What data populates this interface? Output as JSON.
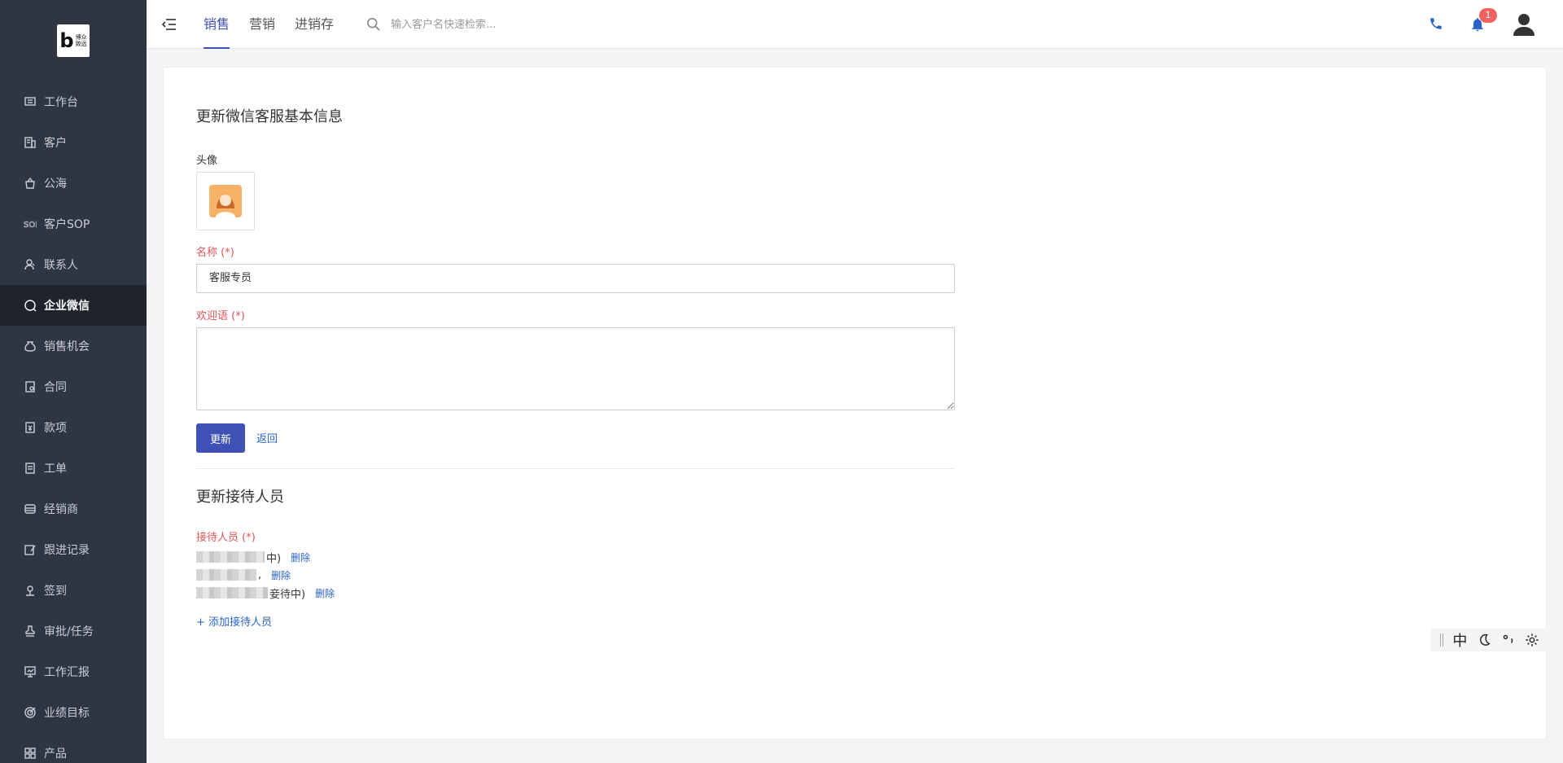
{
  "sidebar": {
    "logo_text": "博众\n致远",
    "items": [
      {
        "label": "工作台",
        "icon": "desk-icon"
      },
      {
        "label": "客户",
        "icon": "building-icon"
      },
      {
        "label": "公海",
        "icon": "basket-icon"
      },
      {
        "label": "客户SOP",
        "icon": "sop-icon"
      },
      {
        "label": "联系人",
        "icon": "person-icon"
      },
      {
        "label": "企业微信",
        "icon": "chat-icon",
        "active": true
      },
      {
        "label": "销售机会",
        "icon": "moneybag-icon"
      },
      {
        "label": "合同",
        "icon": "contract-icon"
      },
      {
        "label": "款项",
        "icon": "payment-icon"
      },
      {
        "label": "工单",
        "icon": "ticket-icon"
      },
      {
        "label": "经销商",
        "icon": "store-icon"
      },
      {
        "label": "跟进记录",
        "icon": "edit-icon"
      },
      {
        "label": "签到",
        "icon": "location-icon"
      },
      {
        "label": "审批/任务",
        "icon": "stamp-icon"
      },
      {
        "label": "工作汇报",
        "icon": "report-icon"
      },
      {
        "label": "业绩目标",
        "icon": "target-icon"
      },
      {
        "label": "产品",
        "icon": "grid-icon"
      }
    ]
  },
  "header": {
    "tabs": [
      {
        "label": "销售",
        "active": true
      },
      {
        "label": "营销"
      },
      {
        "label": "进销存"
      }
    ],
    "search_placeholder": "输入客户名快速检索...",
    "notification_count": "1"
  },
  "form": {
    "basic_title": "更新微信客服基本信息",
    "avatar_label": "头像",
    "name_label": "名称 (*)",
    "name_value": "客服专员",
    "welcome_label": "欢迎语 (*)",
    "welcome_value": "",
    "update_button": "更新",
    "back_link": "返回"
  },
  "receptionists": {
    "title": "更新接待人员",
    "label": "接待人员 (*)",
    "items": [
      {
        "prefix": "",
        "suffix": "中)",
        "delete": "删除"
      },
      {
        "prefix": "",
        "suffix": ",",
        "delete": "删除"
      },
      {
        "prefix": "",
        "suffix": "妾待中)",
        "delete": "删除"
      }
    ],
    "add_link": "+ 添加接待人员"
  },
  "ime": {
    "mode": "中"
  }
}
